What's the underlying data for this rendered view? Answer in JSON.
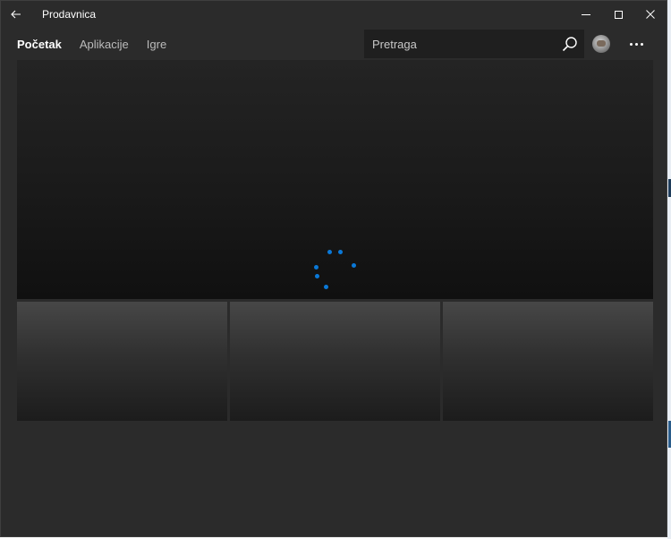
{
  "window": {
    "title": "Prodavnica",
    "back_icon": "back-arrow-icon",
    "controls": [
      "minimize-icon",
      "maximize-icon",
      "close-icon"
    ]
  },
  "nav": {
    "items": [
      {
        "label": "Početak",
        "active": true
      },
      {
        "label": "Aplikacije",
        "active": false
      },
      {
        "label": "Igre",
        "active": false
      }
    ]
  },
  "search": {
    "placeholder": "Pretraga",
    "icon": "search-icon"
  },
  "account": {
    "avatar_icon": "user-avatar-icon",
    "more_icon": "more-ellipsis-icon"
  },
  "hero": {
    "state": "loading",
    "spinner_icon": "loading-spinner-icon",
    "accent_color": "#0a78d7"
  },
  "tiles": [
    {
      "id": "tile-1",
      "state": "loading"
    },
    {
      "id": "tile-2",
      "state": "loading"
    },
    {
      "id": "tile-3",
      "state": "loading"
    }
  ],
  "colors": {
    "background": "#2b2b2b",
    "search_background": "#1f1f1f",
    "accent": "#0a78d7"
  }
}
